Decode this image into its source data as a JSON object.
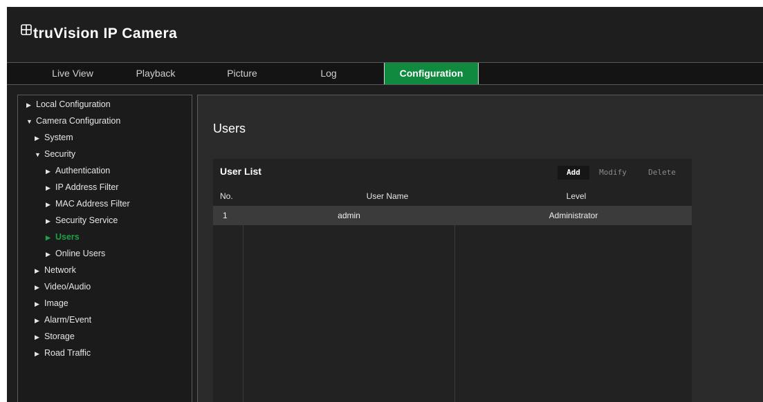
{
  "header": {
    "logo_text": "truVision  IP Camera"
  },
  "nav": {
    "tabs": [
      {
        "label": "Live View"
      },
      {
        "label": "Playback"
      },
      {
        "label": "Picture"
      },
      {
        "label": "Log"
      },
      {
        "label": "Configuration",
        "active": true
      }
    ]
  },
  "sidebar": {
    "items": [
      {
        "label": "Local Configuration",
        "expanded": false
      },
      {
        "label": "Camera Configuration",
        "expanded": true
      },
      {
        "label": "System",
        "expanded": false
      },
      {
        "label": "Security",
        "expanded": true
      },
      {
        "label": "Authentication",
        "expanded": false
      },
      {
        "label": "IP Address Filter",
        "expanded": false
      },
      {
        "label": "MAC Address Filter",
        "expanded": false
      },
      {
        "label": "Security Service",
        "expanded": false
      },
      {
        "label": "Users",
        "expanded": false,
        "selected": true
      },
      {
        "label": "Online Users",
        "expanded": false
      },
      {
        "label": "Network",
        "expanded": false
      },
      {
        "label": "Video/Audio",
        "expanded": false
      },
      {
        "label": "Image",
        "expanded": false
      },
      {
        "label": "Alarm/Event",
        "expanded": false
      },
      {
        "label": "Storage",
        "expanded": false
      },
      {
        "label": "Road Traffic",
        "expanded": false
      }
    ]
  },
  "main": {
    "page_title": "Users",
    "panel_title": "User List",
    "buttons": {
      "add": "Add",
      "modify": "Modify",
      "delete": "Delete"
    },
    "table": {
      "columns": [
        "No.",
        "User Name",
        "Level"
      ],
      "rows": [
        [
          "1",
          "admin",
          "Administrator"
        ]
      ]
    }
  },
  "colors": {
    "accent": "#0f8a3f",
    "selected_text": "#1fa046",
    "background": "#1e1e1e"
  }
}
